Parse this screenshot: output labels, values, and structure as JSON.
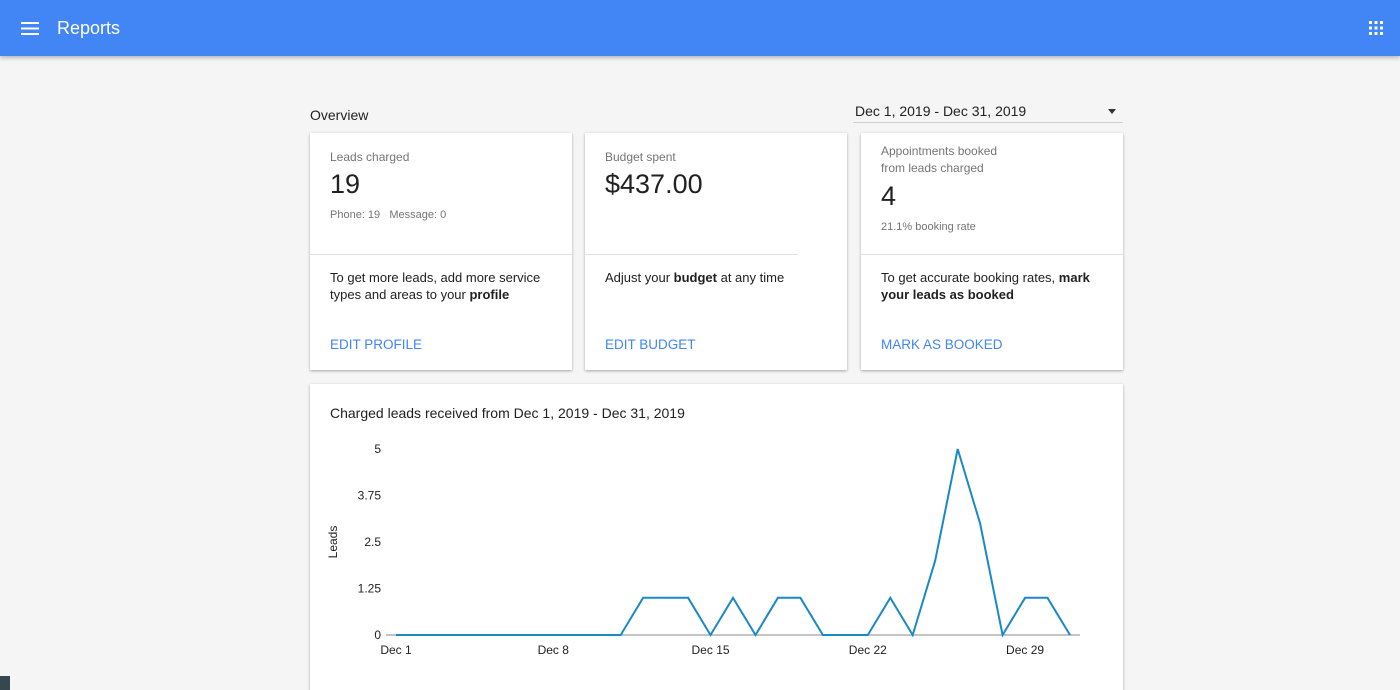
{
  "app": {
    "title": "Reports",
    "menu_icon": "hamburger-menu-icon",
    "apps_icon": "apps-grid-icon",
    "bar_color": "#4285f4"
  },
  "overview": {
    "label": "Overview",
    "date_range": "Dec 1, 2019 - Dec 31, 2019"
  },
  "cards": [
    {
      "label_line1": "Leads charged",
      "label_line2": "",
      "value": "19",
      "sub": "Phone: 19   Message: 0",
      "tip_pre": "To get more leads, add more service types and areas to your ",
      "tip_bold": "profile",
      "action": "EDIT PROFILE"
    },
    {
      "label_line1": "Budget spent",
      "label_line2": "",
      "value": "$437.00",
      "sub": "",
      "tip_pre": "Adjust your ",
      "tip_bold": "budget",
      "tip_post": " at any time",
      "action": "EDIT BUDGET"
    },
    {
      "label_line1": "Appointments booked",
      "label_line2": "from leads charged",
      "value": "4",
      "sub": "21.1% booking rate",
      "tip_pre": "To get accurate booking rates, ",
      "tip_bold": "mark your leads as booked",
      "action": "MARK AS BOOKED"
    }
  ],
  "accent_color": "#4285f4",
  "chart": {
    "title": "Charged leads received from Dec 1, 2019 - Dec 31, 2019"
  },
  "chart_data": {
    "type": "line",
    "title": "Charged leads received from Dec 1, 2019 - Dec 31, 2019",
    "xlabel": "",
    "ylabel": "Leads",
    "x": [
      "Dec 1",
      "Dec 2",
      "Dec 3",
      "Dec 4",
      "Dec 5",
      "Dec 6",
      "Dec 7",
      "Dec 8",
      "Dec 9",
      "Dec 10",
      "Dec 11",
      "Dec 12",
      "Dec 13",
      "Dec 14",
      "Dec 15",
      "Dec 16",
      "Dec 17",
      "Dec 18",
      "Dec 19",
      "Dec 20",
      "Dec 21",
      "Dec 22",
      "Dec 23",
      "Dec 24",
      "Dec 25",
      "Dec 26",
      "Dec 27",
      "Dec 28",
      "Dec 29",
      "Dec 30",
      "Dec 31"
    ],
    "x_tick_labels": [
      "Dec 1",
      "Dec 8",
      "Dec 15",
      "Dec 22",
      "Dec 29"
    ],
    "x_tick_index": [
      0,
      7,
      14,
      21,
      28
    ],
    "y_ticks": [
      "5",
      "3.75",
      "2.5",
      "1.25",
      "0"
    ],
    "ylim": [
      0,
      5
    ],
    "series": [
      {
        "name": "",
        "color": "#1a8ac4",
        "values": [
          0,
          0,
          0,
          0,
          0,
          0,
          0,
          0,
          0,
          0,
          0,
          1,
          1,
          1,
          0,
          1,
          0,
          1,
          1,
          0,
          0,
          0,
          1,
          0,
          2,
          5,
          3,
          0,
          1,
          1,
          0
        ]
      }
    ],
    "grid": false,
    "legend": "none"
  }
}
